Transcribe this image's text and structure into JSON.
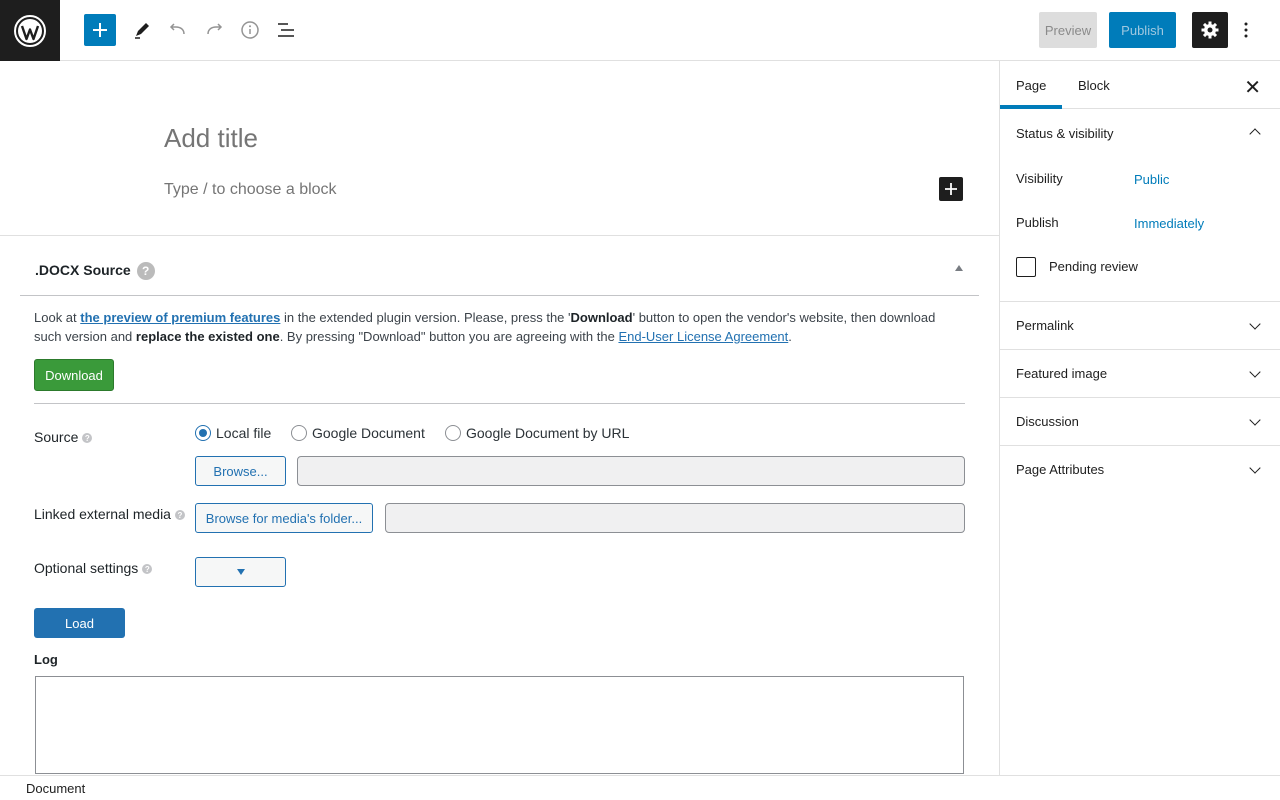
{
  "toolbar": {
    "preview_label": "Preview",
    "publish_label": "Publish"
  },
  "editor": {
    "title_placeholder": "Add title",
    "block_placeholder": "Type / to choose a block"
  },
  "metabox": {
    "title": ".DOCX Source",
    "help_glyph": "?",
    "notice": {
      "t1": "Look at ",
      "link1": "the preview of premium features",
      "t2": " in the extended plugin version. Please, press the '",
      "b1": "Download",
      "t3": "' button to open the vendor's website, then download such version and ",
      "b2": "replace the existed one",
      "t4": ". By pressing \"Download\" button you are agreeing with the ",
      "link2": "End-User License Agreement",
      "t5": "."
    },
    "download_label": "Download",
    "source_label": "Source",
    "radios": [
      "Local file",
      "Google Document",
      "Google Document by URL"
    ],
    "selected_radio": "Local file",
    "browse_label": "Browse...",
    "linked_label": "Linked external media",
    "browse_media_label": "Browse for media's folder...",
    "optional_label": "Optional settings",
    "load_label": "Load",
    "log_label": "Log"
  },
  "statusbar": {
    "label": "Document"
  },
  "sidebar": {
    "tabs": [
      "Page",
      "Block"
    ],
    "active_tab": "Page",
    "close_glyph": "✕",
    "status": {
      "title": "Status & visibility",
      "visibility_label": "Visibility",
      "visibility_value": "Public",
      "publish_label": "Publish",
      "publish_value": "Immediately",
      "pending_label": "Pending review"
    },
    "panels": [
      "Permalink",
      "Featured image",
      "Discussion",
      "Page Attributes"
    ]
  },
  "colors": {
    "accent": "#007cba",
    "dark": "#1e1e1e",
    "download_green": "#3a9a3a",
    "admin_blue": "#2271b1"
  }
}
